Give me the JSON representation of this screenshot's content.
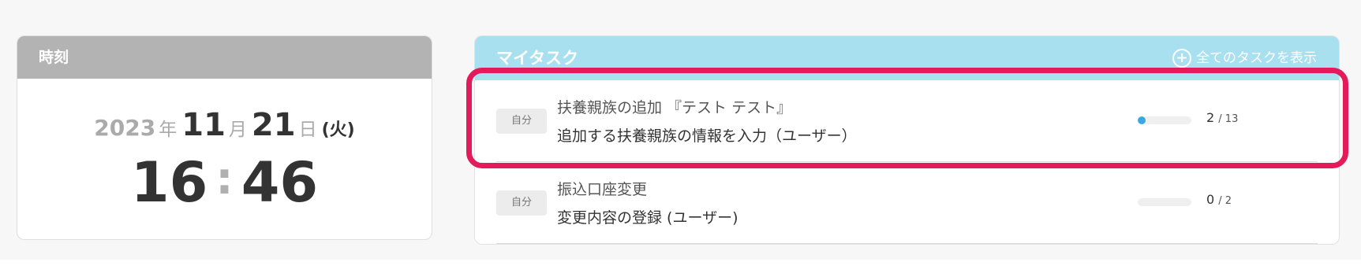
{
  "clock": {
    "header": "時刻",
    "year": "2023",
    "year_unit": "年",
    "month": "11",
    "month_unit": "月",
    "day": "21",
    "day_unit": "日",
    "weekday": "(火)",
    "hour": "16",
    "separator": ":",
    "minute": "46"
  },
  "tasks": {
    "header": "マイタスク",
    "show_all_label": "全てのタスクを表示",
    "show_all_icon": "plus-circle-icon",
    "items": [
      {
        "badge": "自分",
        "title": "扶養親族の追加 『テスト テスト』",
        "subtitle": "追加する扶養親族の情報を入力（ユーザー）",
        "done": "2",
        "total": "/ 13",
        "progress_fraction": 0.154
      },
      {
        "badge": "自分",
        "title": "振込口座変更",
        "subtitle": "変更内容の登録 (ユーザー)",
        "done": "0",
        "total": "/ 2",
        "progress_fraction": 0
      }
    ]
  },
  "colors": {
    "clock_header_bg": "#b3b3b3",
    "task_header_bg": "#a8e0f0",
    "progress_fill": "#37a9e0",
    "highlight_border": "#e31b5b"
  }
}
